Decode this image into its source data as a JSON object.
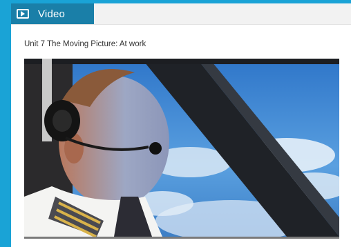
{
  "tab": {
    "icon": "video-play-icon",
    "label": "Video"
  },
  "unit_title": "Unit 7 The Moving Picture: At work",
  "video": {
    "description_icon": "video-frame",
    "accent_color": "#1a7fa8"
  }
}
